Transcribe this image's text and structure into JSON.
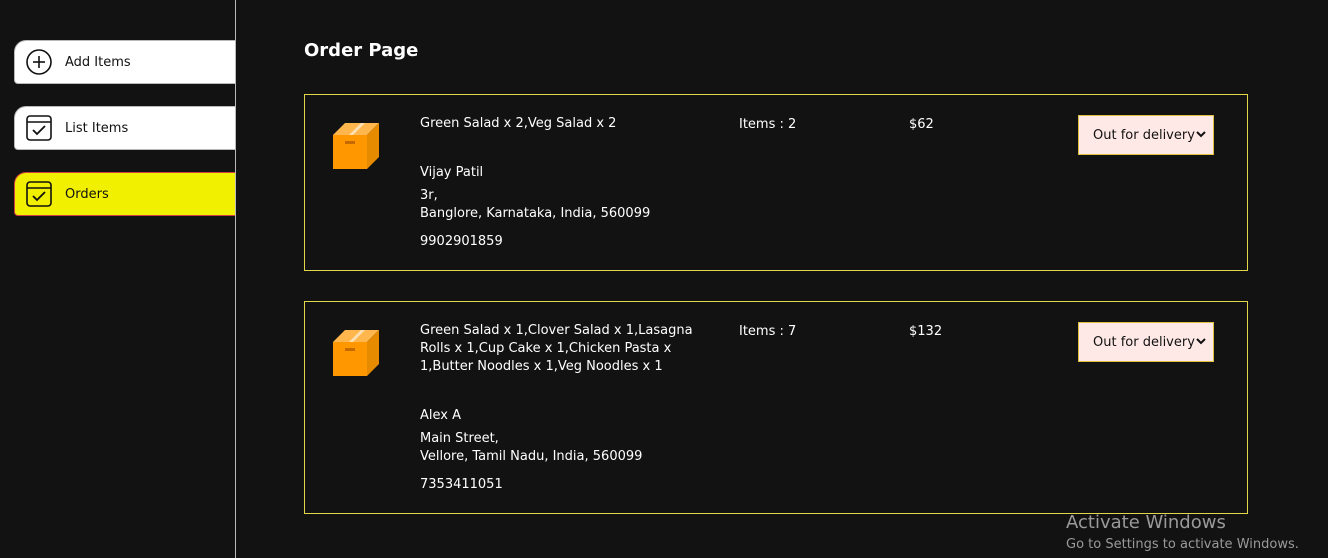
{
  "sidebar": {
    "items": [
      {
        "label": "Add Items",
        "icon": "plus-circle-icon"
      },
      {
        "label": "List Items",
        "icon": "checklist-icon"
      },
      {
        "label": "Orders",
        "icon": "checklist-icon"
      }
    ],
    "active_item": "Orders"
  },
  "main": {
    "title": "Order Page",
    "orders": [
      {
        "items": "Green Salad x 2,Veg Salad x 2",
        "name": "Vijay Patil",
        "address_line1": "3r,",
        "address_line2": "Banglore, Karnataka, India, 560099",
        "phone": "9902901859",
        "count": "Items : 2",
        "amount": "$62",
        "status": "Out for delivery"
      },
      {
        "items": "Green Salad x 1,Clover Salad x 1,Lasagna Rolls x 1,Cup Cake x 1,Chicken Pasta x 1,Butter Noodles x 1,Veg Noodles x 1",
        "name": "Alex A",
        "address_line1": "Main Street,",
        "address_line2": "Vellore, Tamil Nadu, India, 560099",
        "phone": "7353411051",
        "count": "Items : 7",
        "amount": "$132",
        "status": "Out for delivery"
      }
    ]
  },
  "watermark": {
    "line1": "Activate Windows",
    "line2": "Go to Settings to activate Windows."
  },
  "colors": {
    "background": "#121212",
    "active_item": "#f0f000",
    "order_border": "#e0d84a",
    "status_bg": "#ffe9e6",
    "box_icon": "#ff9800"
  }
}
